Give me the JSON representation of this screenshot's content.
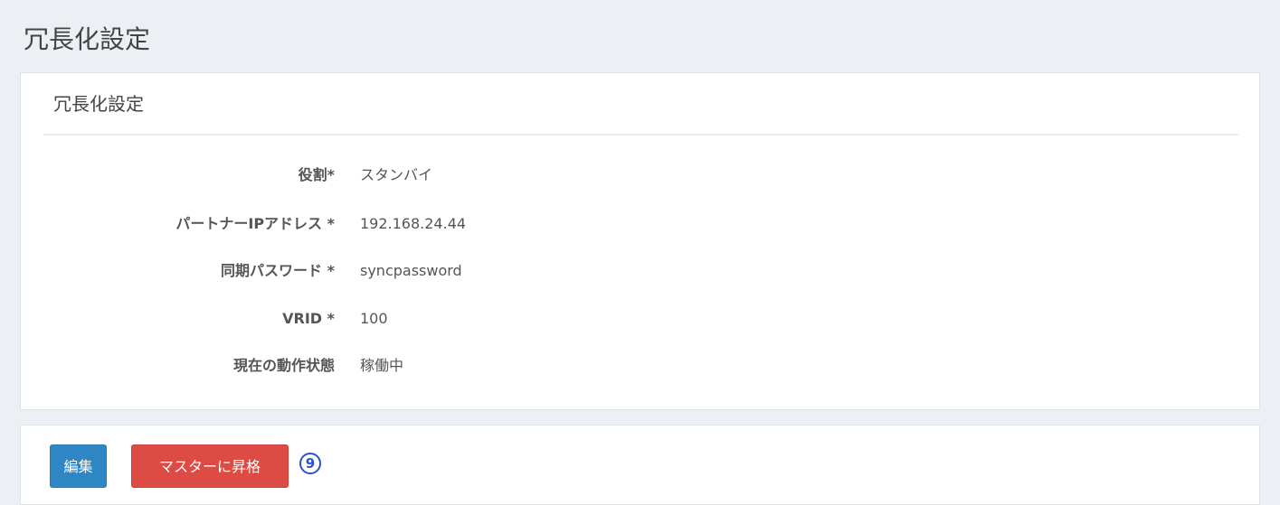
{
  "page": {
    "title": "冗長化設定"
  },
  "settings_box": {
    "title": "冗長化設定",
    "fields": [
      {
        "label": "役割*",
        "value": "スタンバイ"
      },
      {
        "label": "パートナーIPアドレス *",
        "value": "192.168.24.44"
      },
      {
        "label": "同期パスワード *",
        "value": "syncpassword"
      },
      {
        "label": "VRID *",
        "value": "100"
      },
      {
        "label": "現在の動作状態",
        "value": "稼働中"
      }
    ]
  },
  "actions": {
    "edit_label": "編集",
    "promote_label": "マスターに昇格",
    "step_marker": "9",
    "colors": {
      "edit": "#2e86c4",
      "promote": "#dd4b45",
      "marker": "#2c4fd4"
    }
  }
}
